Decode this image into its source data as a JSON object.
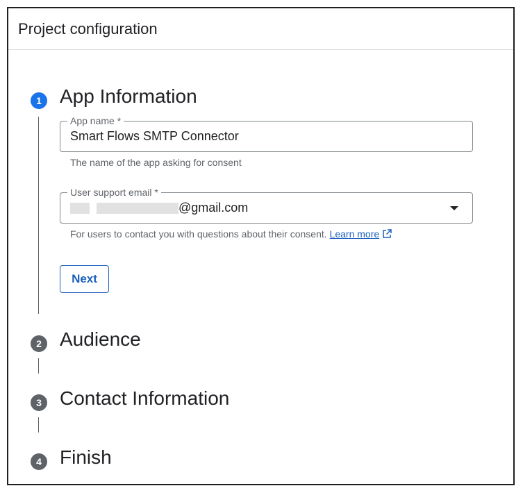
{
  "header": {
    "title": "Project configuration"
  },
  "steps": [
    {
      "number": "1",
      "title": "App Information"
    },
    {
      "number": "2",
      "title": "Audience"
    },
    {
      "number": "3",
      "title": "Contact Information"
    },
    {
      "number": "4",
      "title": "Finish"
    }
  ],
  "app_info": {
    "app_name": {
      "label": "App name *",
      "value": "Smart Flows SMTP Connector",
      "helper": "The name of the app asking for consent"
    },
    "support_email": {
      "label": "User support email *",
      "value_visible": "@gmail.com",
      "helper": "For users to contact you with questions about their consent.",
      "learn_more": "Learn more"
    },
    "next_label": "Next"
  },
  "colors": {
    "accent": "#1a73e8",
    "link": "#1a5fbf",
    "inactive_step": "#5f6368",
    "border": "#80868b"
  },
  "icons": {
    "dropdown": "dropdown-caret-icon",
    "external_link": "external-link-icon"
  }
}
